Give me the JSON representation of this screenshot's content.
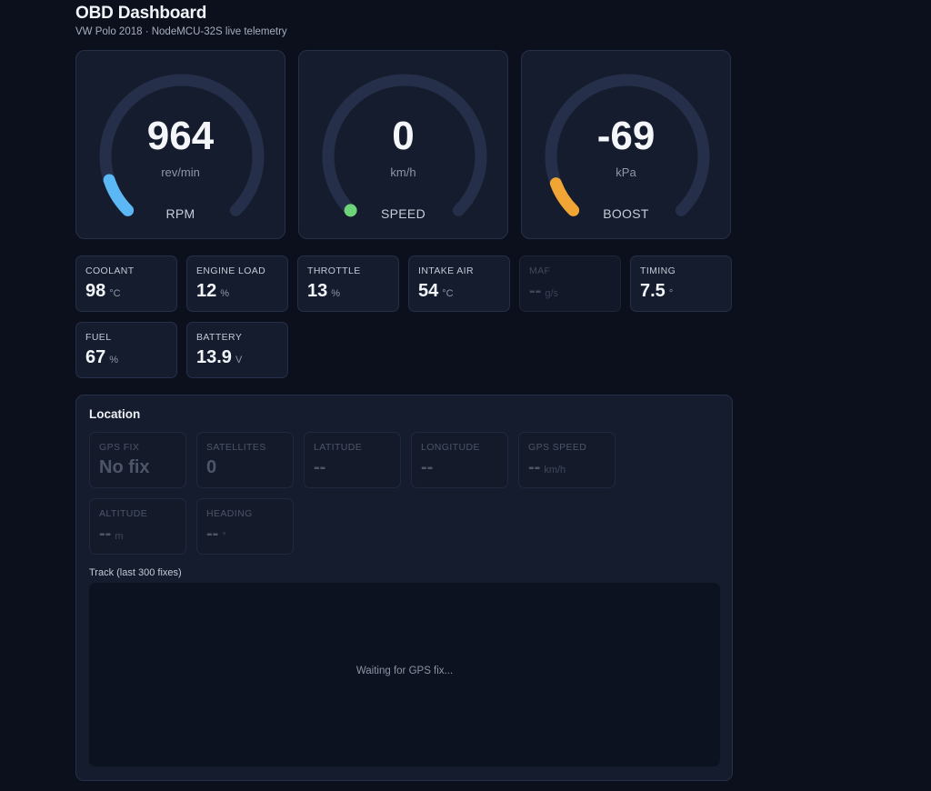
{
  "header": {
    "title": "OBD Dashboard",
    "subtitle": "VW Polo 2018 · NodeMCU-32S live telemetry"
  },
  "gauges": [
    {
      "id": "rpm",
      "value": "964",
      "unit": "rev/min",
      "label": "RPM",
      "fraction": 0.1,
      "color": "#5bb8f5"
    },
    {
      "id": "speed",
      "value": "0",
      "unit": "km/h",
      "label": "SPEED",
      "fraction": 0.0,
      "color": "#6ed47a"
    },
    {
      "id": "boost",
      "value": "-69",
      "unit": "kPa",
      "label": "BOOST",
      "fraction": 0.09,
      "color": "#f0a535"
    }
  ],
  "metrics": [
    {
      "label": "COOLANT",
      "value": "98",
      "unit": "°C"
    },
    {
      "label": "ENGINE LOAD",
      "value": "12",
      "unit": "%"
    },
    {
      "label": "THROTTLE",
      "value": "13",
      "unit": "%"
    },
    {
      "label": "INTAKE AIR",
      "value": "54",
      "unit": "°C"
    },
    {
      "label": "MAF",
      "value": "--",
      "unit": "g/s",
      "dim": true
    },
    {
      "label": "TIMING",
      "value": "7.5",
      "unit": "°"
    },
    {
      "label": "FUEL",
      "value": "67",
      "unit": "%"
    },
    {
      "label": "BATTERY",
      "value": "13.9",
      "unit": "V"
    }
  ],
  "location": {
    "title": "Location",
    "fields": [
      {
        "label": "GPS FIX",
        "value": "No fix",
        "unit": ""
      },
      {
        "label": "SATELLITES",
        "value": "0",
        "unit": ""
      },
      {
        "label": "LATITUDE",
        "value": "--",
        "unit": ""
      },
      {
        "label": "LONGITUDE",
        "value": "--",
        "unit": ""
      },
      {
        "label": "GPS SPEED",
        "value": "--",
        "unit": "km/h"
      },
      {
        "label": "ALTITUDE",
        "value": "--",
        "unit": "m"
      },
      {
        "label": "HEADING",
        "value": "--",
        "unit": "°"
      }
    ],
    "track_label": "Track (last 300 fixes)",
    "waiting_text": "Waiting for GPS fix..."
  },
  "colors": {
    "background": "#0b101c",
    "card": "#151c2d",
    "gauge_track": "#252f49"
  }
}
